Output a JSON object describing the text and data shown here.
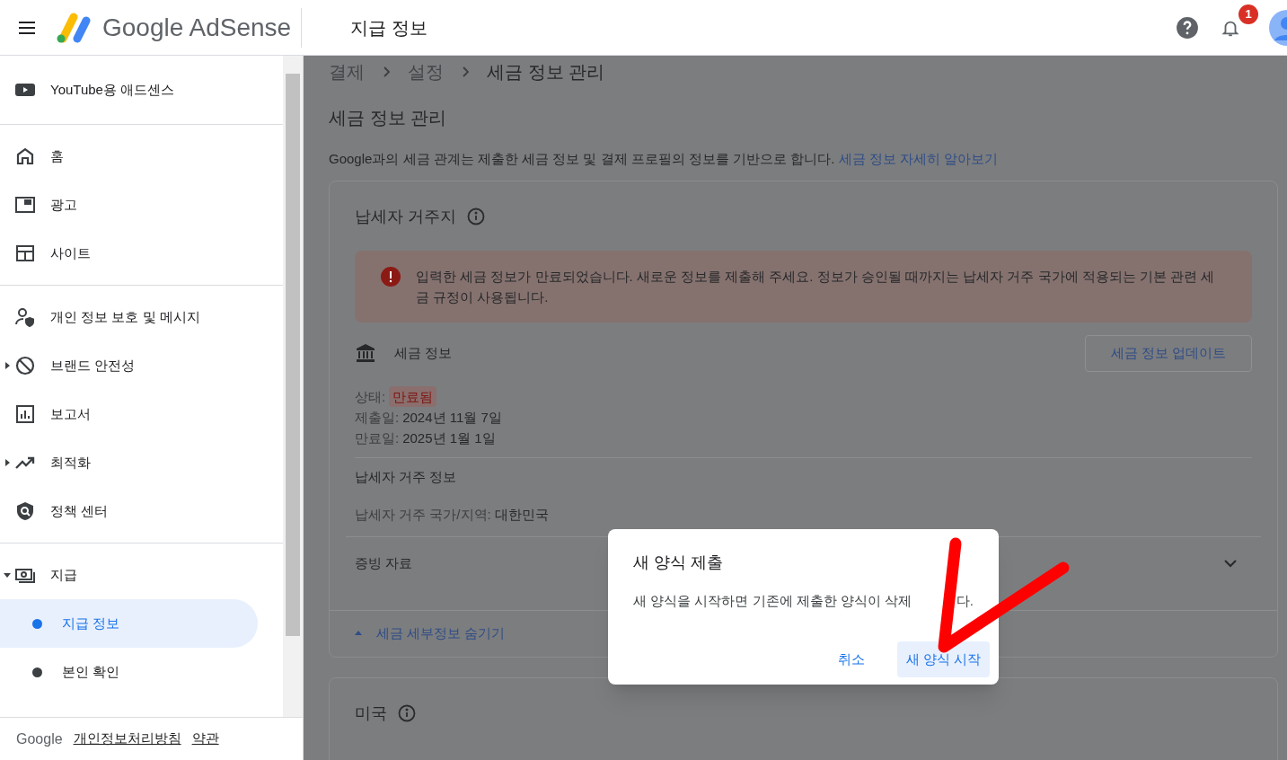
{
  "header": {
    "brand": "Google AdSense",
    "title": "지급 정보",
    "notification_count": "1"
  },
  "sidebar": {
    "top_item": {
      "label": "YouTube용 애드센스"
    },
    "sections": [
      {
        "items": [
          {
            "label": "홈",
            "selected": false
          },
          {
            "label": "광고",
            "selected": false
          },
          {
            "label": "사이트",
            "selected": false
          }
        ]
      },
      {
        "items": [
          {
            "label": "개인 정보 보호 및 메시지",
            "selected": false
          },
          {
            "label": "브랜드 안전성",
            "selected": false,
            "expanded": false
          },
          {
            "label": "보고서",
            "selected": false
          },
          {
            "label": "최적화",
            "selected": false,
            "expanded": false
          },
          {
            "label": "정책 센터",
            "selected": false
          }
        ]
      },
      {
        "items": [
          {
            "label": "지급",
            "selected": false,
            "expanded": true,
            "children": [
              {
                "label": "지급 정보",
                "selected": true
              },
              {
                "label": "본인 확인",
                "selected": false
              }
            ]
          }
        ]
      }
    ],
    "footer": {
      "brand": "Google",
      "links": [
        "개인정보처리방침",
        "약관"
      ]
    }
  },
  "main": {
    "breadcrumb": [
      "결제",
      "설정",
      "세금 정보 관리"
    ],
    "heading": "세금 정보 관리",
    "description": "Google과의 세금 관계는 제출한 세금 정보 및 결제 프로필의 정보를 기반으로 합니다.",
    "description_link": "세금 정보 자세히 알아보기",
    "card": {
      "title": "납세자 거주지",
      "alert": "입력한 세금 정보가 만료되었습니다. 새로운 정보를 제출해 주세요. 정보가 승인될 때까지는 납세자 거주 국가에 적용되는 기본 관련 세금 규정이 사용됩니다.",
      "tax_info_label": "세금 정보",
      "update_button": "세금 정보 업데이트",
      "status_label": "상태:",
      "status_value": "만료됨",
      "fields": [
        {
          "label": "제출일:",
          "value": "2024년 11월 7일"
        },
        {
          "label": "만료일:",
          "value": "2025년 1월 1일"
        }
      ],
      "residence_heading": "납세자 거주 정보",
      "residence_field": {
        "label": "납세자 거주 국가/지역:",
        "value": "대한민국"
      },
      "accordion": {
        "label": "증빙 자료",
        "expanded": false
      },
      "toggle_link": "세금 세부정보 숨기기"
    },
    "second_card": {
      "title": "미국"
    }
  },
  "dialog": {
    "title": "새 양식 제출",
    "body": "새 양식을 시작하면 기존에 제출한 양식이 삭제",
    "body_tail": "다.",
    "buttons": [
      {
        "label": "취소",
        "kind": "text"
      },
      {
        "label": "새 양식 시작",
        "kind": "tonal"
      }
    ]
  }
}
